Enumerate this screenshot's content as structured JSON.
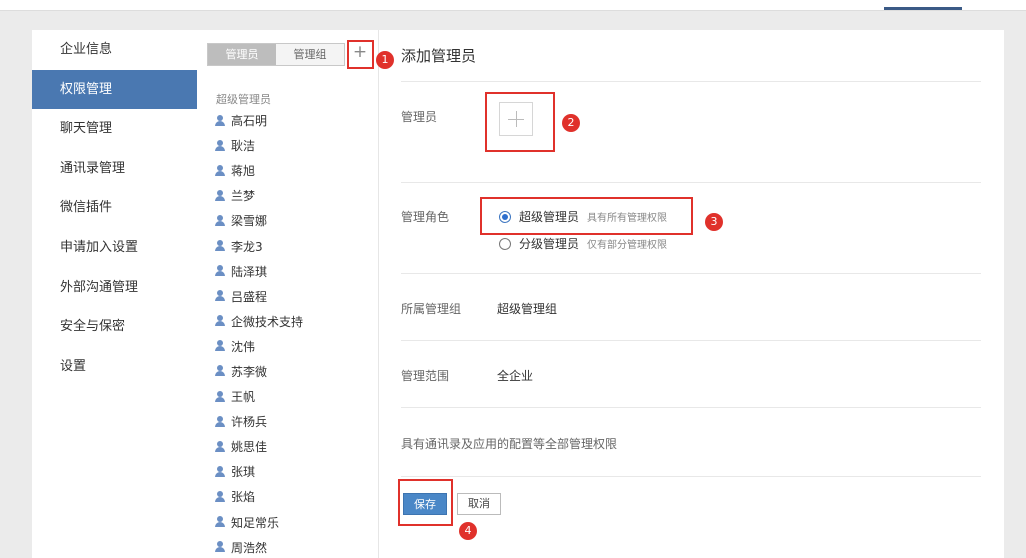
{
  "nav": {
    "items": [
      {
        "label": "企业信息"
      },
      {
        "label": "权限管理",
        "active": true
      },
      {
        "label": "聊天管理"
      },
      {
        "label": "通讯录管理"
      },
      {
        "label": "微信插件"
      },
      {
        "label": "申请加入设置"
      },
      {
        "label": "外部沟通管理"
      },
      {
        "label": "安全与保密"
      },
      {
        "label": "设置"
      }
    ]
  },
  "middle": {
    "tabs": [
      {
        "label": "管理员",
        "active": true
      },
      {
        "label": "管理组"
      }
    ],
    "add_label": "+",
    "group_title": "超级管理员",
    "admins": [
      "高石明",
      "耿洁",
      "蒋旭",
      "兰梦",
      "梁雪娜",
      "李龙3",
      "陆泽琪",
      "吕盛程",
      "企微技术支持",
      "沈伟",
      "苏李微",
      "王帆",
      "许杨兵",
      "姚思佳",
      "张琪",
      "张焰",
      "知足常乐",
      "周浩然"
    ]
  },
  "main": {
    "title": "添加管理员",
    "admin_label": "管理员",
    "role_label": "管理角色",
    "roles": [
      {
        "label": "超级管理员",
        "desc": "具有所有管理权限",
        "checked": true
      },
      {
        "label": "分级管理员",
        "desc": "仅有部分管理权限",
        "checked": false
      }
    ],
    "group_label": "所属管理组",
    "group_value": "超级管理组",
    "scope_label": "管理范围",
    "scope_value": "全企业",
    "description": "具有通讯录及应用的配置等全部管理权限",
    "save_label": "保存",
    "cancel_label": "取消"
  },
  "annotations": [
    "1",
    "2",
    "3",
    "4"
  ],
  "colors": {
    "accent": "#4a78b1",
    "save_button": "#4a87c7",
    "highlight": "#e0312b"
  }
}
